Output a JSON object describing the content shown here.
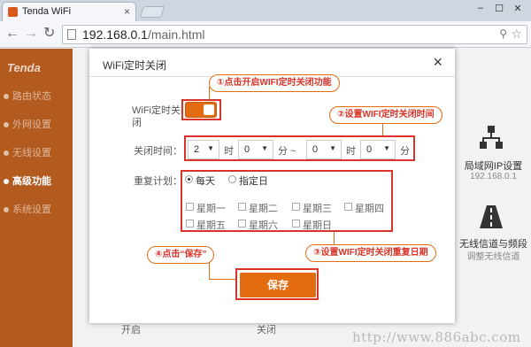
{
  "browser": {
    "tab_title": "Tenda WiFi",
    "tab_close": "×",
    "window_controls": [
      "–",
      "☐",
      "✕"
    ],
    "url_host": "192.168.0.1",
    "url_path": "/main.html",
    "nav_icons": [
      "back-icon",
      "forward-icon",
      "reload-icon"
    ],
    "omnibox_icons": [
      "zoom-icon",
      "star-icon"
    ]
  },
  "router": {
    "logo": "Tenda",
    "nav": [
      {
        "label": "路由状态",
        "active": false
      },
      {
        "label": "外网设置",
        "active": false
      },
      {
        "label": "无线设置",
        "active": false
      },
      {
        "label": "高级功能",
        "active": true
      },
      {
        "label": "系统设置",
        "active": false
      }
    ],
    "right_cards": [
      {
        "title": "局域网IP设置",
        "sub": "192.168.0.1",
        "icon": "network-icon"
      },
      {
        "title": "无线信道与频段",
        "sub": "调整无线信道",
        "icon": "road-icon"
      }
    ],
    "bottom_labels": [
      "开启",
      "关闭"
    ],
    "accent_color": "#e46c10",
    "sidebar_color": "#b35a1f"
  },
  "modal": {
    "title": "WiFi定时关闭",
    "close": "×",
    "wifi_timer_label": "WiFi定时关闭",
    "wifi_timer_enabled": true,
    "off_time_label": "关闭时间：",
    "start_hour": "2",
    "start_minute": "0",
    "end_hour": "0",
    "end_minute": "0",
    "unit_hour": "时",
    "unit_minute": "分",
    "range_sep": "分 ~",
    "repeat_label": "重复计划：",
    "repeat_options": [
      {
        "label": "每天",
        "checked": true
      },
      {
        "label": "指定日",
        "checked": false
      }
    ],
    "weekdays": [
      "星期一",
      "星期二",
      "星期三",
      "星期四",
      "星期五",
      "星期六",
      "星期日"
    ],
    "save_label": "保存"
  },
  "annotations": {
    "step1": "①点击开启WIFI定时关闭功能",
    "step2": "②设置WIFI定时关闭时间",
    "step3": "③设置WIFI定时关闭重复日期",
    "step4": "④点击“保存”",
    "color": "#d8342a"
  },
  "watermark": "http://www.886abc.com"
}
